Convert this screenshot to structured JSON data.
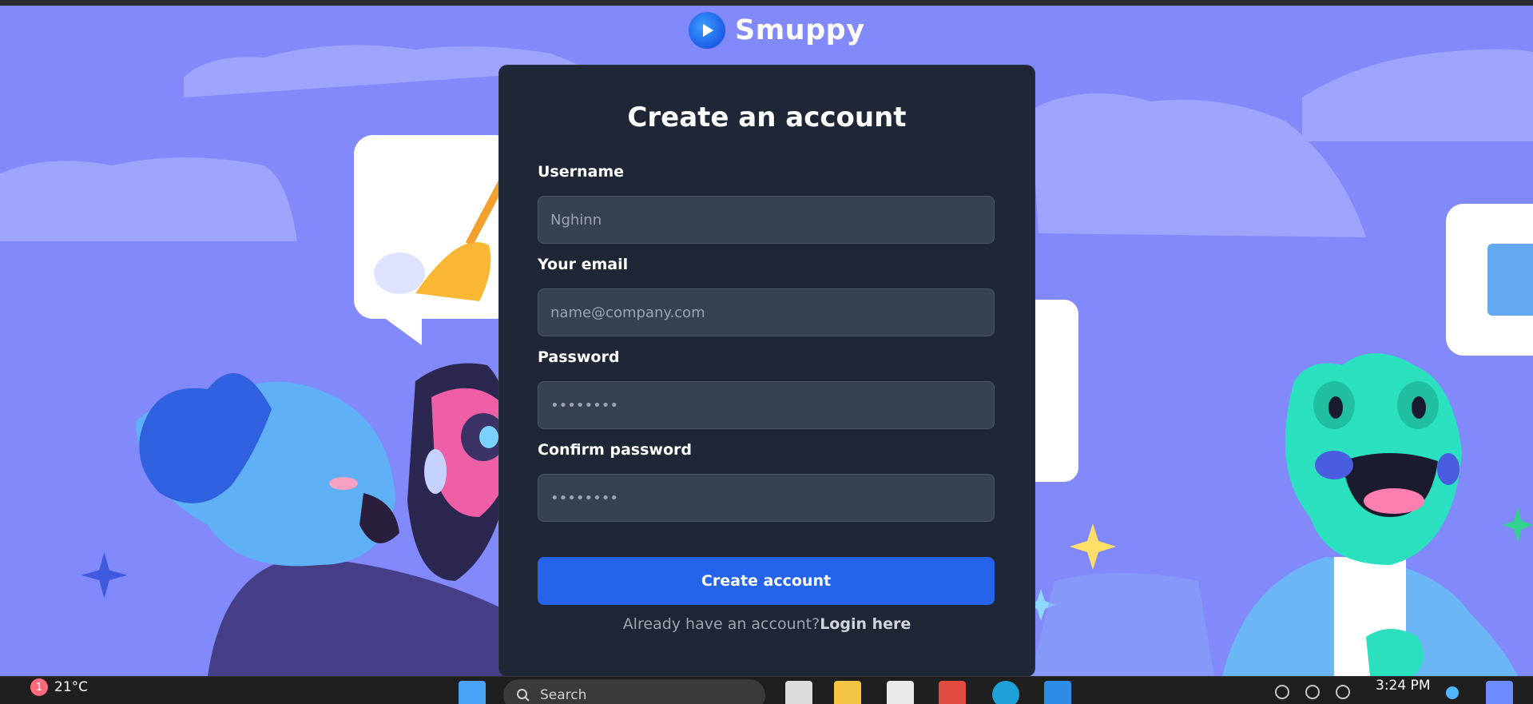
{
  "brand": {
    "name": "Smuppy"
  },
  "form": {
    "title": "Create an account",
    "fields": [
      {
        "label": "Username",
        "placeholder": "Nghinn",
        "type": "text"
      },
      {
        "label": "Your email",
        "placeholder": "name@company.com",
        "type": "email"
      },
      {
        "label": "Password",
        "placeholder": "••••••••",
        "type": "password"
      },
      {
        "label": "Confirm password",
        "placeholder": "••••••••",
        "type": "password"
      }
    ],
    "submit_label": "Create account",
    "login_prompt": "Already have an account?",
    "login_link": "Login here"
  },
  "taskbar": {
    "weather_badge": "1",
    "weather_temp": "21°C",
    "search_placeholder": "Search",
    "clock_time": "3:24 PM"
  },
  "colors": {
    "background": "#8189fb",
    "card": "#1f2737",
    "input": "#374151",
    "primary": "#2563eb",
    "taskbar": "#1f1f1f"
  }
}
